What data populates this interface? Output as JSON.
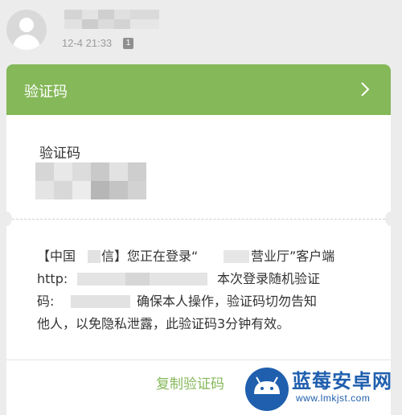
{
  "message": {
    "timestamp": "12-4 21:33",
    "sim_slot": "1"
  },
  "card": {
    "header_title": "验证码",
    "chevron_icon": "chevron-right-icon",
    "code_label": "验证码",
    "sms_lines": [
      "【中国",
      "信】您正在登录“",
      "营业厅”客户端",
      "http:",
      "本次登录随机验证",
      "码:",
      "确保本人操作，验证码切勿告知",
      "他人，以免隐私泄露，此验证码3分钟有效。"
    ],
    "copy_button": "复制验证码"
  },
  "watermark": {
    "brand_text": "蓝莓安卓网",
    "url": "www.lmkjst.com"
  },
  "colors": {
    "accent_green": "#85b859",
    "watermark_blue": "#1f5fae",
    "background": "#ececec"
  }
}
